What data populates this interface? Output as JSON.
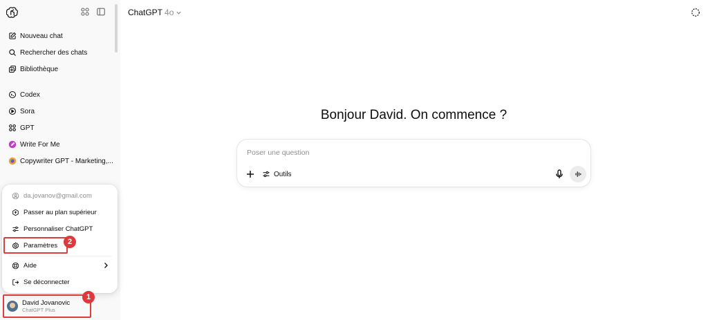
{
  "sidebar": {
    "nav": [
      {
        "label": "Nouveau chat",
        "icon": "edit-icon"
      },
      {
        "label": "Rechercher des chats",
        "icon": "search-icon"
      },
      {
        "label": "Bibliothèque",
        "icon": "library-icon"
      }
    ],
    "apps": [
      {
        "label": "Codex",
        "icon": "codex-icon"
      },
      {
        "label": "Sora",
        "icon": "play-icon"
      },
      {
        "label": "GPT",
        "icon": "grid-icon"
      }
    ],
    "gpts": [
      {
        "label": "Write For Me",
        "icon": "write-for-me-icon"
      },
      {
        "label": "Copywriter GPT - Marketing,...",
        "icon": "copywriter-icon"
      }
    ]
  },
  "account_menu": {
    "email": "da.jovanov@gmail.com",
    "items": [
      {
        "label": "Passer au plan supérieur",
        "icon": "upgrade-icon"
      },
      {
        "label": "Personnaliser ChatGPT",
        "icon": "sliders-icon"
      },
      {
        "label": "Paramètres",
        "icon": "gear-icon"
      },
      {
        "label": "Aide",
        "icon": "help-icon"
      },
      {
        "label": "Se déconnecter",
        "icon": "logout-icon"
      }
    ]
  },
  "profile": {
    "name": "David Jovanovic",
    "plan": "ChatGPT Plus"
  },
  "header": {
    "model": "ChatGPT",
    "version": "4o"
  },
  "main": {
    "greeting": "Bonjour David. On commence ?"
  },
  "composer": {
    "placeholder": "Poser une question",
    "tools_label": "Outils"
  },
  "annotations": {
    "badge_1": "1",
    "badge_2": "2"
  },
  "colors": {
    "highlight": "#e03c3c",
    "sidebar_bg": "#f9f9f9"
  }
}
